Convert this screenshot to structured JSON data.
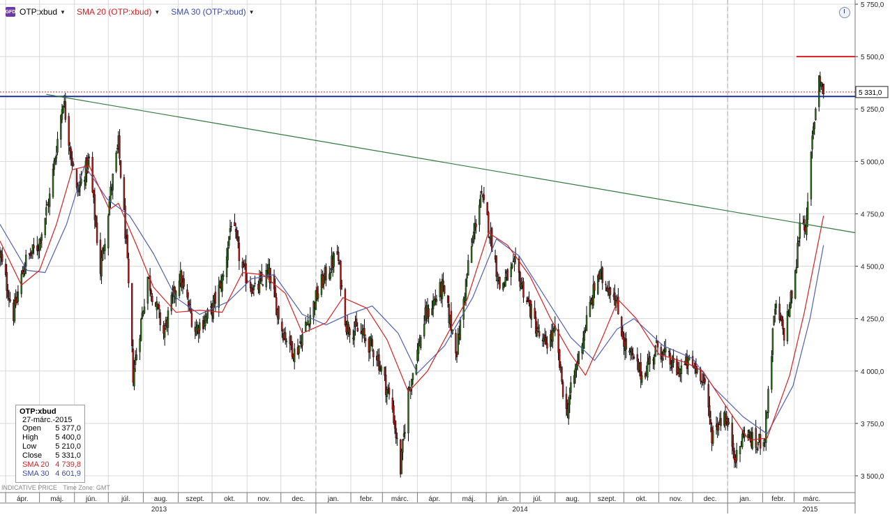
{
  "legend": {
    "app_icon": "GFD",
    "items": [
      {
        "label": "OTP:xbud",
        "color": "#000000"
      },
      {
        "label": "SMA 20 (OTP:xbud)",
        "color": "#d42020"
      },
      {
        "label": "SMA 30 (OTP:xbud)",
        "color": "#3a4aa8"
      }
    ],
    "caret": "▼"
  },
  "price_tag": "5 331,0",
  "info": {
    "symbol": "OTP:xbud",
    "date": "27-márc.-2015",
    "rows": [
      {
        "label": "Open",
        "value": "5 377,0",
        "color": "#000000"
      },
      {
        "label": "High",
        "value": "5 400,0",
        "color": "#000000"
      },
      {
        "label": "Low",
        "value": "5 210,0",
        "color": "#000000"
      },
      {
        "label": "Close",
        "value": "5 331,0",
        "color": "#000000"
      },
      {
        "label": "SMA 20",
        "value": "4 739,8",
        "color": "#d42020"
      },
      {
        "label": "SMA 30",
        "value": "4 601,9",
        "color": "#3a4aa8"
      }
    ]
  },
  "footnote": {
    "left": "INDICATIVE PRICE",
    "right": "Time Zone: GMT"
  },
  "colors": {
    "up": "#2f6e1a",
    "down": "#b01818",
    "wick": "#000000",
    "sma20": "#d42020",
    "sma30": "#5060b0",
    "resistance": "#1c2f8f",
    "trendline": "#2f7a3a",
    "target": "#d42020",
    "close_line": "#d42020",
    "grid": "#d8d8d8"
  },
  "chart_data": {
    "type": "candlestick",
    "title": "OTP:xbud",
    "y_ticks": [
      "5 750,0",
      "5 500,0",
      "5 250,0",
      "5 000,0",
      "4 750,0",
      "4 500,0",
      "4 250,0",
      "4 000,0",
      "3 750,0",
      "3 500,0"
    ],
    "y_tick_values": [
      5750,
      5500,
      5250,
      5000,
      4750,
      4500,
      4250,
      4000,
      3750,
      3500
    ],
    "ylim": [
      3420,
      5770
    ],
    "x_months": [
      "ápr.",
      "máj.",
      "jún.",
      "júl.",
      "aug.",
      "szept.",
      "okt.",
      "nov.",
      "dec.",
      "jan.",
      "febr.",
      "márc.",
      "ápr.",
      "máj.",
      "jún.",
      "júl.",
      "aug.",
      "szept.",
      "okt.",
      "nov.",
      "dec.",
      "jan.",
      "febr.",
      "márc."
    ],
    "x_years": [
      "2013",
      "2014",
      "2015"
    ],
    "xlim": [
      "2013-03-27",
      "2015-04-24"
    ],
    "month_starts": [
      "2013-04-01",
      "2013-05-01",
      "2013-06-01",
      "2013-07-01",
      "2013-08-01",
      "2013-09-01",
      "2013-10-01",
      "2013-11-01",
      "2013-12-01",
      "2014-01-01",
      "2014-02-01",
      "2014-03-01",
      "2014-04-01",
      "2014-05-01",
      "2014-06-01",
      "2014-07-01",
      "2014-08-01",
      "2014-09-01",
      "2014-10-01",
      "2014-11-01",
      "2014-12-01",
      "2015-01-01",
      "2015-02-01",
      "2015-03-01"
    ],
    "year_centers": [
      "2013-08-15",
      "2014-07-01",
      "2015-03-15"
    ],
    "close_path": [
      [
        "2013-03-27",
        4550
      ],
      [
        "2013-04-08",
        4270
      ],
      [
        "2013-04-18",
        4520
      ],
      [
        "2013-04-30",
        4600
      ],
      [
        "2013-05-10",
        4830
      ],
      [
        "2013-05-22",
        5300
      ],
      [
        "2013-06-03",
        4850
      ],
      [
        "2013-06-14",
        5000
      ],
      [
        "2013-06-24",
        4480
      ],
      [
        "2013-07-03",
        4850
      ],
      [
        "2013-07-10",
        5080
      ],
      [
        "2013-07-17",
        4600
      ],
      [
        "2013-07-23",
        3980
      ],
      [
        "2013-08-05",
        4450
      ],
      [
        "2013-08-19",
        4180
      ],
      [
        "2013-09-02",
        4460
      ],
      [
        "2013-09-16",
        4200
      ],
      [
        "2013-09-30",
        4280
      ],
      [
        "2013-10-11",
        4450
      ],
      [
        "2013-10-18",
        4720
      ],
      [
        "2013-10-28",
        4480
      ],
      [
        "2013-11-08",
        4380
      ],
      [
        "2013-11-20",
        4470
      ],
      [
        "2013-12-02",
        4200
      ],
      [
        "2013-12-14",
        4080
      ],
      [
        "2014-01-06",
        4420
      ],
      [
        "2014-01-20",
        4560
      ],
      [
        "2014-01-28",
        4220
      ],
      [
        "2014-02-10",
        4180
      ],
      [
        "2014-02-24",
        4080
      ],
      [
        "2014-03-10",
        3820
      ],
      [
        "2014-03-17",
        3530
      ],
      [
        "2014-03-24",
        3900
      ],
      [
        "2014-04-08",
        4260
      ],
      [
        "2014-04-23",
        4400
      ],
      [
        "2014-05-06",
        4100
      ],
      [
        "2014-05-16",
        4500
      ],
      [
        "2014-05-27",
        4840
      ],
      [
        "2014-06-03",
        4700
      ],
      [
        "2014-06-13",
        4400
      ],
      [
        "2014-06-27",
        4500
      ],
      [
        "2014-07-07",
        4340
      ],
      [
        "2014-07-21",
        4120
      ],
      [
        "2014-08-01",
        4180
      ],
      [
        "2014-08-11",
        3800
      ],
      [
        "2014-08-25",
        4150
      ],
      [
        "2014-09-08",
        4460
      ],
      [
        "2014-09-22",
        4380
      ],
      [
        "2014-10-02",
        4120
      ],
      [
        "2014-10-17",
        3980
      ],
      [
        "2014-10-31",
        4120
      ],
      [
        "2014-11-17",
        4000
      ],
      [
        "2014-11-28",
        4040
      ],
      [
        "2014-12-10",
        3980
      ],
      [
        "2014-12-18",
        3700
      ],
      [
        "2014-12-29",
        3800
      ],
      [
        "2015-01-09",
        3580
      ],
      [
        "2015-01-16",
        3720
      ],
      [
        "2015-01-26",
        3640
      ],
      [
        "2015-02-03",
        3700
      ],
      [
        "2015-02-12",
        4300
      ],
      [
        "2015-02-20",
        4180
      ],
      [
        "2015-03-02",
        4450
      ],
      [
        "2015-03-06",
        4720
      ],
      [
        "2015-03-12",
        4700
      ],
      [
        "2015-03-17",
        5100
      ],
      [
        "2015-03-23",
        5420
      ],
      [
        "2015-03-27",
        5331
      ]
    ],
    "sma20_path": [
      [
        "2013-03-27",
        4620
      ],
      [
        "2013-04-15",
        4410
      ],
      [
        "2013-05-01",
        4480
      ],
      [
        "2013-05-16",
        4700
      ],
      [
        "2013-05-30",
        4960
      ],
      [
        "2013-06-14",
        4980
      ],
      [
        "2013-07-02",
        4770
      ],
      [
        "2013-07-10",
        4800
      ],
      [
        "2013-07-26",
        4600
      ],
      [
        "2013-08-10",
        4400
      ],
      [
        "2013-08-30",
        4280
      ],
      [
        "2013-09-20",
        4290
      ],
      [
        "2013-10-10",
        4280
      ],
      [
        "2013-10-28",
        4470
      ],
      [
        "2013-11-15",
        4460
      ],
      [
        "2013-12-05",
        4370
      ],
      [
        "2013-12-20",
        4180
      ],
      [
        "2014-01-10",
        4230
      ],
      [
        "2014-01-25",
        4350
      ],
      [
        "2014-02-15",
        4300
      ],
      [
        "2014-03-05",
        4150
      ],
      [
        "2014-03-24",
        3900
      ],
      [
        "2014-04-10",
        4000
      ],
      [
        "2014-04-28",
        4180
      ],
      [
        "2014-05-15",
        4340
      ],
      [
        "2014-06-03",
        4660
      ],
      [
        "2014-06-20",
        4600
      ],
      [
        "2014-07-10",
        4450
      ],
      [
        "2014-07-28",
        4250
      ],
      [
        "2014-08-15",
        4080
      ],
      [
        "2014-08-28",
        3980
      ],
      [
        "2014-09-12",
        4160
      ],
      [
        "2014-09-26",
        4340
      ],
      [
        "2014-10-12",
        4250
      ],
      [
        "2014-11-01",
        4080
      ],
      [
        "2014-11-25",
        4040
      ],
      [
        "2014-12-10",
        4000
      ],
      [
        "2015-01-01",
        3820
      ],
      [
        "2015-01-20",
        3670
      ],
      [
        "2015-02-05",
        3680
      ],
      [
        "2015-02-25",
        3980
      ],
      [
        "2015-03-10",
        4280
      ],
      [
        "2015-03-27",
        4740
      ]
    ],
    "sma30_path": [
      [
        "2013-03-27",
        4700
      ],
      [
        "2013-04-20",
        4480
      ],
      [
        "2013-05-06",
        4470
      ],
      [
        "2013-05-25",
        4700
      ],
      [
        "2013-06-10",
        4980
      ],
      [
        "2013-06-30",
        4820
      ],
      [
        "2013-07-20",
        4740
      ],
      [
        "2013-08-10",
        4560
      ],
      [
        "2013-08-30",
        4350
      ],
      [
        "2013-09-20",
        4270
      ],
      [
        "2013-10-15",
        4330
      ],
      [
        "2013-11-05",
        4440
      ],
      [
        "2013-11-25",
        4460
      ],
      [
        "2013-12-20",
        4270
      ],
      [
        "2014-01-10",
        4220
      ],
      [
        "2014-01-30",
        4270
      ],
      [
        "2014-02-20",
        4310
      ],
      [
        "2014-03-15",
        4180
      ],
      [
        "2014-04-01",
        3990
      ],
      [
        "2014-04-25",
        4120
      ],
      [
        "2014-05-20",
        4350
      ],
      [
        "2014-06-10",
        4630
      ],
      [
        "2014-06-30",
        4550
      ],
      [
        "2014-07-20",
        4380
      ],
      [
        "2014-08-15",
        4160
      ],
      [
        "2014-09-05",
        4050
      ],
      [
        "2014-09-25",
        4200
      ],
      [
        "2014-10-10",
        4250
      ],
      [
        "2014-11-05",
        4120
      ],
      [
        "2014-12-01",
        4060
      ],
      [
        "2014-12-20",
        3920
      ],
      [
        "2015-01-15",
        3780
      ],
      [
        "2015-02-05",
        3700
      ],
      [
        "2015-02-28",
        3930
      ],
      [
        "2015-03-15",
        4250
      ],
      [
        "2015-03-27",
        4600
      ]
    ],
    "horizontal_lines": [
      {
        "name": "resistance",
        "y": 5310,
        "x_from": "2013-03-27",
        "x_to": "2015-04-24"
      },
      {
        "name": "target",
        "y": 5500,
        "x_from": "2015-03-03",
        "x_to": "2015-04-24"
      },
      {
        "name": "close",
        "y": 5331,
        "x_from": "2013-03-27",
        "x_to": "2015-04-24"
      }
    ],
    "trendline": {
      "from": [
        "2013-05-07",
        5320
      ],
      "to": [
        "2015-04-24",
        4660
      ]
    },
    "grid": true,
    "legend_position": "top-left"
  }
}
